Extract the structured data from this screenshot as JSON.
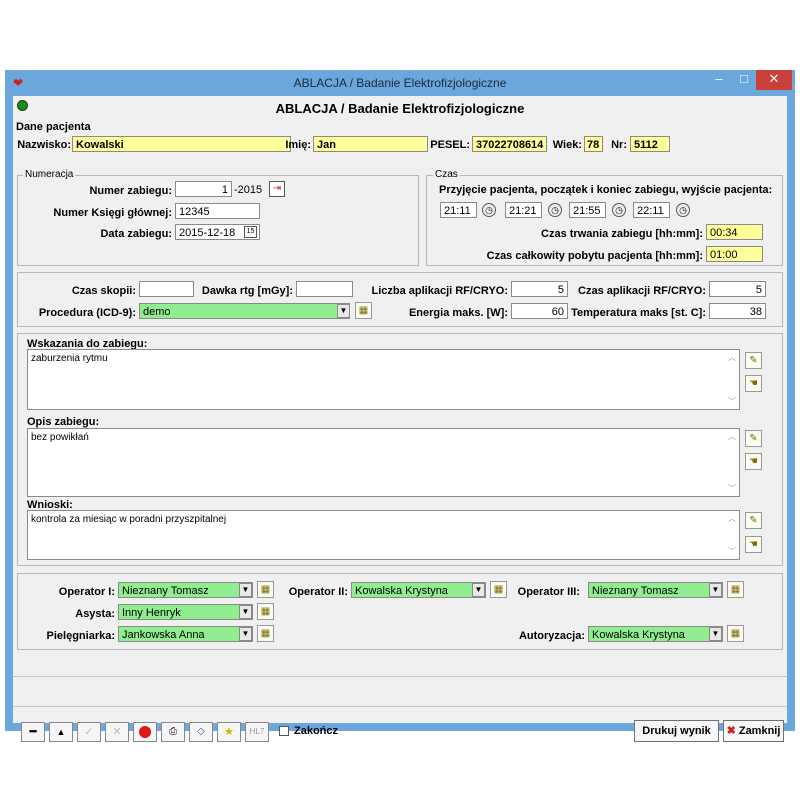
{
  "window": {
    "title": "ABLACJA / Badanie Elektrofizjologiczne",
    "minimize": "–",
    "maximize": "□",
    "close": "✕"
  },
  "form_title": "ABLACJA / Badanie Elektrofizjologiczne",
  "patient": {
    "group_label": "Dane pacjenta",
    "surname_label": "Nazwisko:",
    "surname": "Kowalski",
    "name_label": "Imię:",
    "name": "Jan",
    "pesel_label": "PESEL:",
    "pesel": "37022708614",
    "age_label": "Wiek:",
    "age": "78",
    "nr_label": "Nr:",
    "nr": "5112"
  },
  "numeracja": {
    "group_label": "Numeracja",
    "num_label": "Numer zabiegu:",
    "num_value": "1",
    "num_suffix": "-2015",
    "book_label": "Numer Księgi głównej:",
    "book_value": "12345",
    "date_label": "Data zabiegu:",
    "date_value": "2015-12-18"
  },
  "czas": {
    "group_label": "Czas",
    "header": "Przyjęcie pacjenta, początek i koniec zabiegu, wyjście pacjenta:",
    "times": [
      "21:11",
      "21:21",
      "21:55",
      "22:11"
    ],
    "duration_label": "Czas trwania zabiegu [hh:mm]:",
    "duration": "00:34",
    "total_label": "Czas całkowity pobytu pacjenta [hh:mm]:",
    "total": "01:00"
  },
  "params": {
    "skopia_label": "Czas skopii:",
    "skopia": "",
    "dawka_label": "Dawka rtg [mGy]:",
    "dawka": "",
    "liczba_label": "Liczba aplikacji RF/CRYO:",
    "liczba": "5",
    "czasapl_label": "Czas aplikacji RF/CRYO:",
    "czasapl": "5",
    "procedura_label": "Procedura (ICD-9):",
    "procedura": "demo",
    "energia_label": "Energia maks. [W]:",
    "energia": "60",
    "temp_label": "Temperatura maks [st. C]:",
    "temp": "38"
  },
  "texts": {
    "wskazania_label": "Wskazania do zabiegu:",
    "wskazania": "zaburzenia rytmu",
    "opis_label": "Opis zabiegu:",
    "opis": "bez powikłań",
    "wnioski_label": "Wnioski:",
    "wnioski": "kontrola za miesiąc w poradni przyszpitalnej"
  },
  "staff": {
    "op1_label": "Operator I:",
    "op1": "Nieznany Tomasz",
    "op2_label": "Operator II:",
    "op2": "Kowalska Krystyna",
    "op3_label": "Operator III:",
    "op3": "Nieznany Tomasz",
    "asysta_label": "Asysta:",
    "asysta": "Inny Henryk",
    "piel_label": "Pielęgniarka:",
    "piel": "Jankowska Anna",
    "autor_label": "Autoryzacja:",
    "autor": "Kowalska Krystyna"
  },
  "toolbar": {
    "hl7": "HL7",
    "zakoncz_label": "Zakończ",
    "print_label": "Drukuj wynik",
    "close_label": "Zamknij"
  }
}
